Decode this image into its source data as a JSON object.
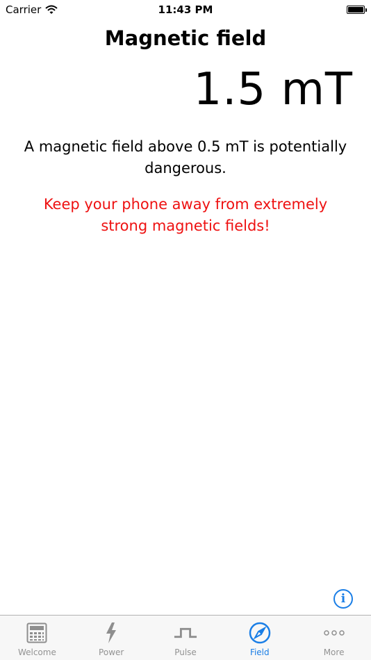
{
  "status_bar": {
    "carrier": "Carrier",
    "time": "11:43 PM"
  },
  "header": {
    "title": "Magnetic field"
  },
  "main": {
    "field_value": "1.5 mT",
    "info_text": "A magnetic field above 0.5 mT is potentially dangerous.",
    "warning_text": "Keep your phone away from extremely strong magnetic fields!",
    "info_button_label": "i"
  },
  "tab_bar": {
    "tabs": [
      {
        "label": "Welcome",
        "icon": "calculator-icon",
        "active": false
      },
      {
        "label": "Power",
        "icon": "lightning-icon",
        "active": false
      },
      {
        "label": "Pulse",
        "icon": "pulse-icon",
        "active": false
      },
      {
        "label": "Field",
        "icon": "compass-icon",
        "active": true
      },
      {
        "label": "More",
        "icon": "more-icon",
        "active": false
      }
    ]
  },
  "colors": {
    "accent": "#1a7ee6",
    "warning": "#ee1111",
    "tab_inactive": "#929292"
  }
}
